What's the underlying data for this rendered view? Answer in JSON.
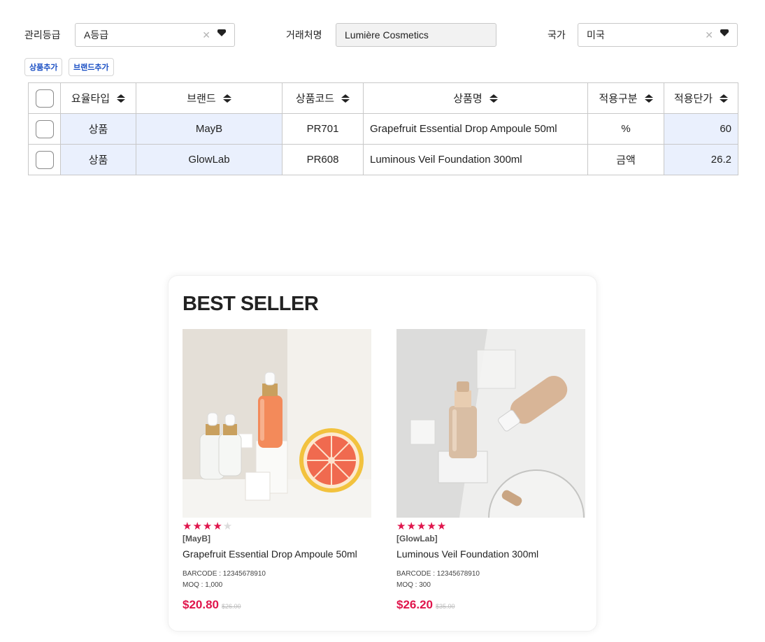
{
  "filters": {
    "grade_label": "관리등급",
    "grade_value": "A등급",
    "partner_label": "거래처명",
    "partner_value": "Lumière Cosmetics",
    "country_label": "국가",
    "country_value": "미국"
  },
  "actions": {
    "add_product": "상품추가",
    "add_brand": "브랜드추가"
  },
  "table": {
    "headers": [
      "요율타입",
      "브랜드",
      "상품코드",
      "상품명",
      "적용구분",
      "적용단가"
    ],
    "rows": [
      {
        "type": "상품",
        "brand": "MayB",
        "code": "PR701",
        "name": "Grapefruit Essential Drop Ampoule 50ml",
        "apply": "%",
        "price": "60"
      },
      {
        "type": "상품",
        "brand": "GlowLab",
        "code": "PR608",
        "name": "Luminous Veil Foundation 300ml",
        "apply": "금액",
        "price": "26.2"
      }
    ]
  },
  "best_seller": {
    "title": "BEST SELLER",
    "products": [
      {
        "rating": 4,
        "brand": "[MayB]",
        "name": "Grapefruit Essential Drop Ampoule 50ml",
        "barcode": "BARCODE : 12345678910",
        "moq": "MOQ : 1,000",
        "price": "$20.80",
        "old_price": "$26.00"
      },
      {
        "rating": 5,
        "brand": "[GlowLab]",
        "name": "Luminous Veil Foundation 300ml",
        "barcode": "BARCODE : 12345678910",
        "moq": "MOQ : 300",
        "price": "$26.20",
        "old_price": "$35.00"
      }
    ]
  },
  "colors": {
    "accent_pink": "#e0154c",
    "link_blue": "#1a4fc4",
    "row_highlight": "#eaf0fd"
  }
}
